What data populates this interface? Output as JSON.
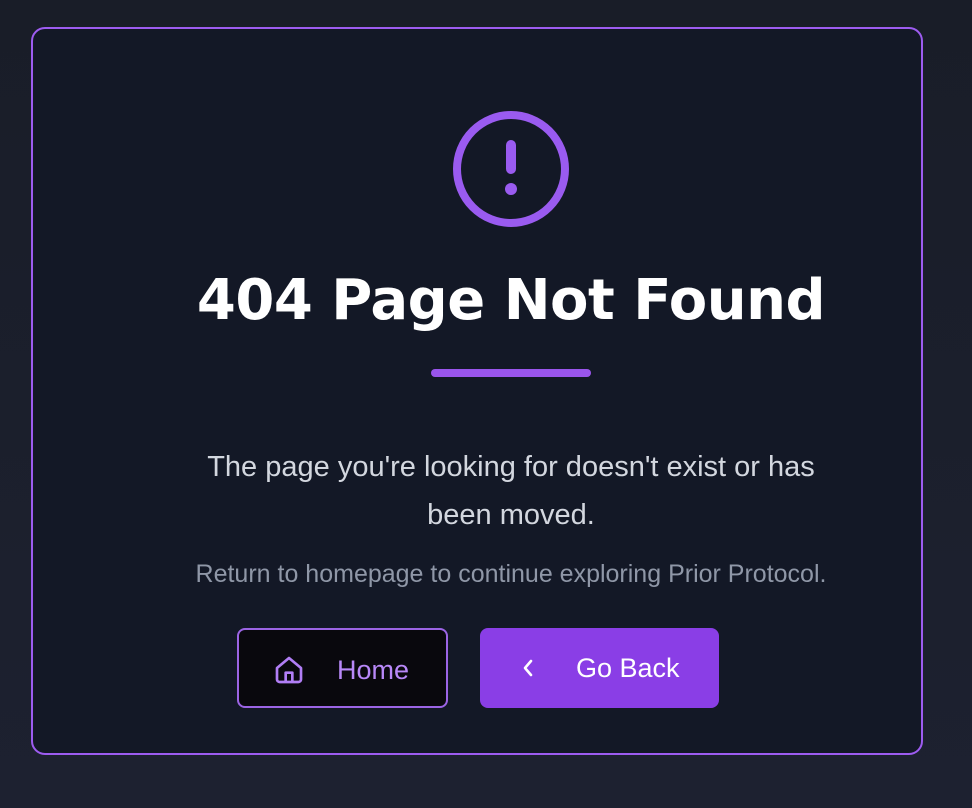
{
  "error": {
    "icon": "alert-circle-icon",
    "title": "404 Page Not Found",
    "message_line1": "The page you're looking for doesn't exist or has",
    "message_line2": "been moved.",
    "subtext": "Return to homepage to continue exploring Prior Protocol."
  },
  "actions": {
    "home": {
      "label": "Home",
      "icon": "home-icon"
    },
    "back": {
      "label": "Go Back",
      "icon": "chevron-left-icon"
    }
  },
  "colors": {
    "accent": "#9a55ec",
    "button_primary": "#8a3ee6",
    "background": "#131826"
  }
}
